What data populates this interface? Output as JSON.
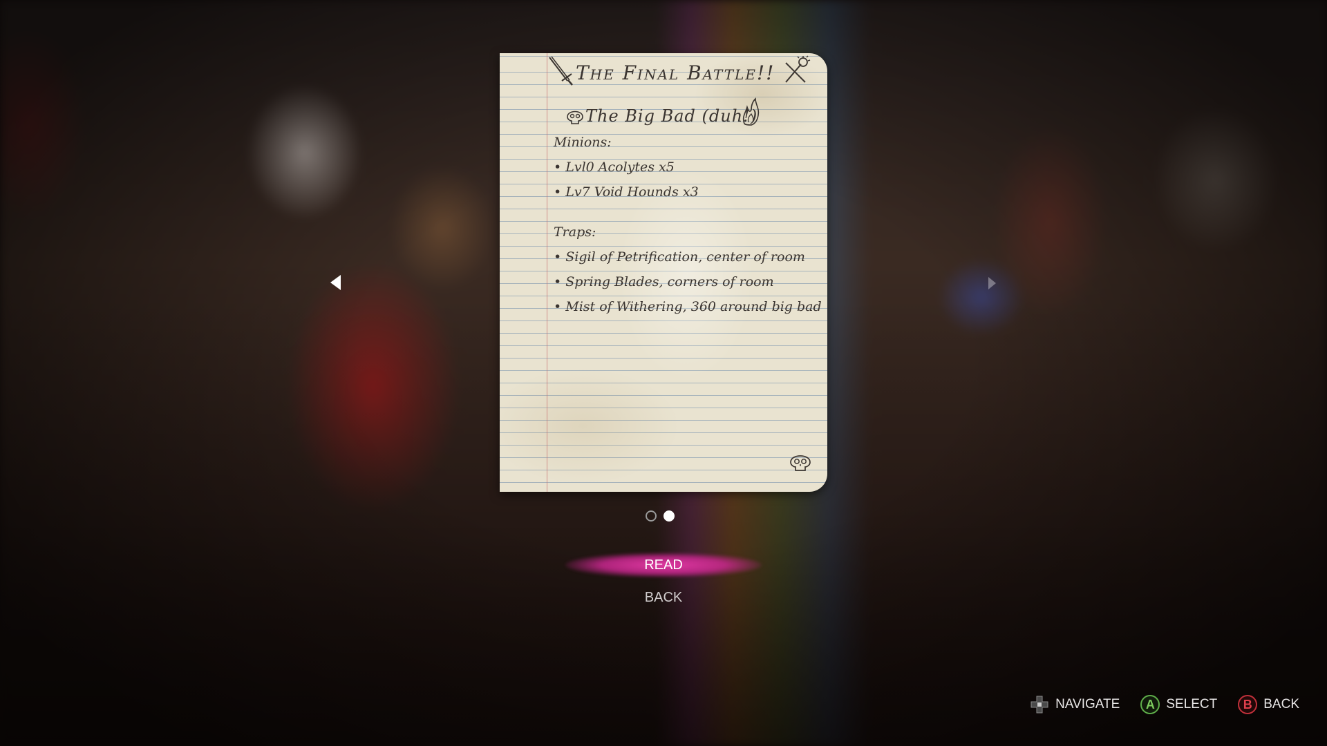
{
  "note": {
    "title": "The Final Battle!!",
    "subtitle": "The Big Bad (duh!)",
    "minions_heading": "Minions:",
    "minions": [
      "• Lvl0 Acolytes x5",
      "• Lv7 Void Hounds x3"
    ],
    "traps_heading": "Traps:",
    "traps": [
      "• Sigil of Petrification, center of room",
      "• Spring Blades, corners of room",
      "• Mist of Withering, 360 around big bad"
    ]
  },
  "pager": {
    "total_pages": 2,
    "current_page": 2
  },
  "menu": {
    "read_label": "READ",
    "back_label": "BACK"
  },
  "hints": {
    "navigate_label": "NAVIGATE",
    "select_button": "A",
    "select_label": "SELECT",
    "back_button": "B",
    "back_label": "BACK"
  },
  "icons": {
    "left_arrow": "prev-page-arrow-icon",
    "right_arrow": "next-page-arrow-icon",
    "dpad": "dpad-icon",
    "sword": "sword-icon",
    "mace": "mace-icon",
    "skull": "skull-icon",
    "fire": "fire-icon"
  },
  "colors": {
    "menu_highlight": "#e03ca8",
    "button_a": "#5fae4a",
    "button_b": "#c0303a"
  }
}
